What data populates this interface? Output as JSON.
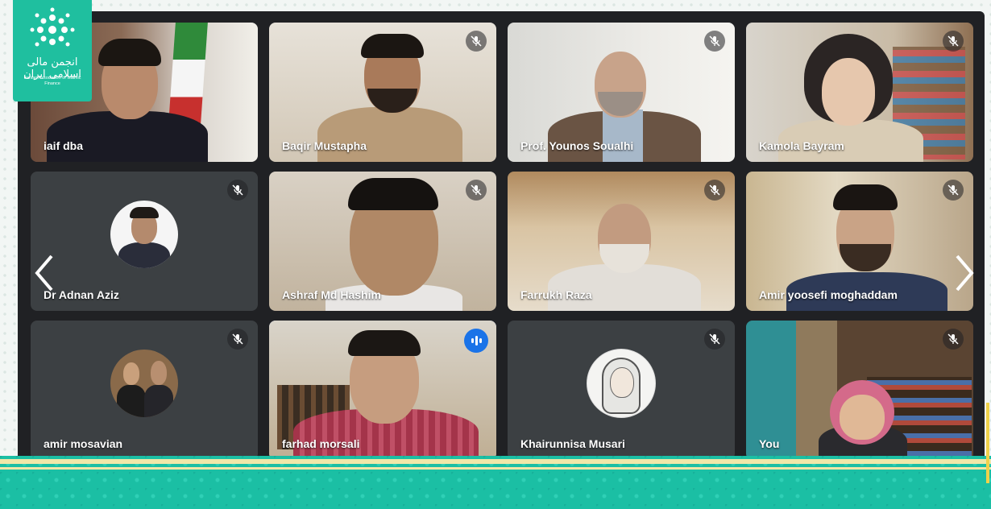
{
  "branding": {
    "org_name_fa": "انجمن مالی اسلامی ایران",
    "org_name_en": "Iranian Association of Islamic Finance"
  },
  "meeting": {
    "participants": [
      {
        "name": "iaif dba",
        "muted": false
      },
      {
        "name": "Baqir Mustapha",
        "muted": true
      },
      {
        "name": "Prof. Younos Soualhi",
        "muted": true
      },
      {
        "name": "Kamola Bayram",
        "muted": true
      },
      {
        "name": "Dr Adnan Aziz",
        "muted": true
      },
      {
        "name": "Ashraf Md Hashim",
        "muted": true
      },
      {
        "name": "Farrukh Raza",
        "muted": true
      },
      {
        "name": "Amir yoosefi moghaddam",
        "muted": true
      },
      {
        "name": "amir mosavian",
        "muted": true
      },
      {
        "name": "farhad morsali",
        "muted": false,
        "speaking": true
      },
      {
        "name": "Khairunnisa Musari",
        "muted": true
      },
      {
        "name": "You",
        "muted": true
      }
    ]
  },
  "icons": {
    "mute": "mic-off-icon",
    "speaking": "audio-level-icon",
    "prev": "chevron-left-icon",
    "next": "chevron-right-icon"
  },
  "colors": {
    "meet_bg": "#202124",
    "tile_bg": "#3c4043",
    "speaking_accent": "#1a73e8",
    "brand_teal": "#1fbf9f"
  }
}
